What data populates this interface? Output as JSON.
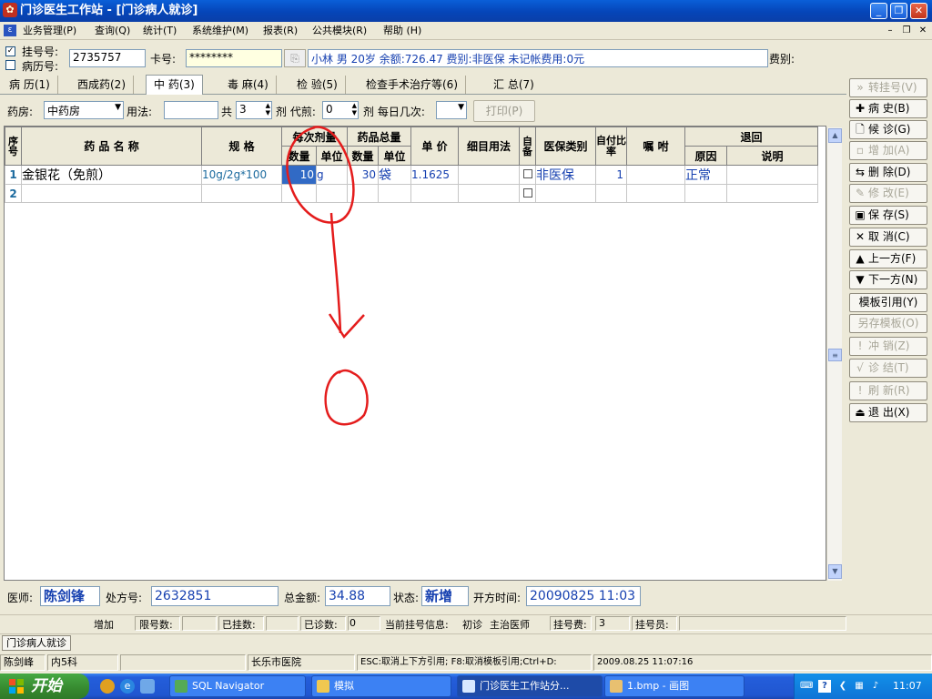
{
  "window": {
    "title": "门诊医生工作站 - [门诊病人就诊]"
  },
  "menu": [
    "业务管理(P)",
    "查询(Q)",
    "统计(T)",
    "系统维护(M)",
    "报表(R)",
    "公共模块(R)",
    "帮助 (H)"
  ],
  "patient": {
    "reg_no_label": "挂号号:",
    "record_no_label": "病历号:",
    "reg_no": "2735757",
    "card_label": "卡号:",
    "card_value": "********",
    "info": "小林 男 20岁 余额:726.47 费别:非医保 未记帐费用:0元",
    "fee_type_label": "费别:"
  },
  "tabs": [
    "病 历(1)",
    "西成药(2)",
    "中 药(3)",
    "毒 麻(4)",
    "检 验(5)",
    "检查手术治疗等(6)",
    "汇 总(7)"
  ],
  "active_tab": 2,
  "tools": {
    "pharmacy_label": "药房:",
    "pharmacy_value": "中药房",
    "usage_label": "用法:",
    "usage_value": "",
    "total_label": "共",
    "total_value": "3",
    "dose_label": "剂 代煎:",
    "decoct_value": "0",
    "daily_label": "剂 每日几次:",
    "daily_value": "",
    "print_label": "打印(P)"
  },
  "table": {
    "headers": {
      "seq": "序号",
      "name": "药 品 名 称",
      "spec": "规 格",
      "per_dose": "每次剂量",
      "qty": "数量",
      "unit": "单位",
      "total_amount": "药品总量",
      "unit_price": "单 价",
      "detail_usage": "细目用法",
      "self_prep": "自备",
      "insurance": "医保类别",
      "self_pay_ratio": "自付比率",
      "instruction": "嘱 咐",
      "return": "退回",
      "reason": "原因",
      "note": "说明"
    },
    "rows": [
      {
        "seq": "1",
        "name": "金银花（免煎）",
        "spec": "10g/2g*100",
        "qty": "10",
        "unit": "g",
        "total_qty": "30",
        "total_unit": "袋",
        "price": "1.1625",
        "detail": "",
        "insurance": "非医保",
        "ratio": "1",
        "instruction": "",
        "reason": "正常",
        "note": ""
      },
      {
        "seq": "2",
        "name": "",
        "spec": "",
        "qty": "",
        "unit": "",
        "total_qty": "",
        "total_unit": "",
        "price": "",
        "detail": "",
        "insurance": "",
        "ratio": "",
        "instruction": "",
        "reason": "",
        "note": ""
      }
    ]
  },
  "side_buttons": [
    {
      "label": "转挂号(V)",
      "icon": "double-arrow-icon",
      "glyph": "»",
      "enabled": false
    },
    {
      "label": "病 史(B)",
      "icon": "plus-icon",
      "glyph": "✚",
      "enabled": true
    },
    {
      "label": "候 诊(G)",
      "icon": "document-icon",
      "glyph": "🗋",
      "enabled": true
    },
    {
      "label": "增 加(A)",
      "icon": "add-document-icon",
      "glyph": "▫",
      "enabled": false
    },
    {
      "label": "删 除(D)",
      "icon": "delete-icon",
      "glyph": "⇆",
      "enabled": true
    },
    {
      "label": "修 改(E)",
      "icon": "edit-icon",
      "glyph": "✎",
      "enabled": false
    },
    {
      "label": "保 存(S)",
      "icon": "save-icon",
      "glyph": "▣",
      "enabled": true
    },
    {
      "label": "取 消(C)",
      "icon": "cancel-icon",
      "glyph": "✕",
      "enabled": true
    },
    {
      "label": "上一方(F)",
      "icon": "up-arrow-icon",
      "glyph": "▲",
      "enabled": true
    },
    {
      "label": "下一方(N)",
      "icon": "down-arrow-icon",
      "glyph": "▼",
      "enabled": true
    },
    {
      "label": "模板引用(Y)",
      "icon": "",
      "glyph": "",
      "enabled": true
    },
    {
      "label": "另存模板(O)",
      "icon": "",
      "glyph": "",
      "enabled": false
    },
    {
      "label": "冲 销(Z)",
      "icon": "exclamation-icon",
      "glyph": "!",
      "enabled": false
    },
    {
      "label": "诊 结(T)",
      "icon": "check-icon",
      "glyph": "√",
      "enabled": false
    },
    {
      "label": "刷 新(R)",
      "icon": "exclamation-icon",
      "glyph": "!",
      "enabled": false
    },
    {
      "label": "退 出(X)",
      "icon": "exit-icon",
      "glyph": "⏏",
      "enabled": true
    }
  ],
  "bottom": {
    "doctor_label": "医师:",
    "doctor_value": "陈剑锋",
    "rx_label": "处方号:",
    "rx_value": "2632851",
    "total_label": "总金额:",
    "total_value": "34.88",
    "state_label": "状态:",
    "state_value": "新增",
    "time_label": "开方时间:",
    "time_value": "20090825 11:03"
  },
  "status_a": {
    "add": "增加",
    "limit": "限号数:",
    "registered": "已挂数:",
    "diagnosed": "已诊数:",
    "diagnosed_value": "0",
    "current_info": "当前挂号信息:",
    "visit_type": "初诊",
    "doctor_type": "主治医师",
    "fee_label": "挂号费:",
    "fee_value": "3",
    "operator_label": "挂号员:"
  },
  "subtab": "门诊病人就诊",
  "status_b": {
    "user": "陈剑峰",
    "dept": "内5科",
    "hospital": "长乐市医院",
    "hint": "ESC:取消上下方引用; F8:取消模板引用;Ctrl+D:",
    "datetime": "2009.08.25 11:07:16"
  },
  "taskbar": {
    "start": "开始",
    "tasks": [
      "SQL Navigator",
      "模拟",
      "门诊医生工作站分...",
      "1.bmp - 画图"
    ],
    "clock": "11:07"
  }
}
